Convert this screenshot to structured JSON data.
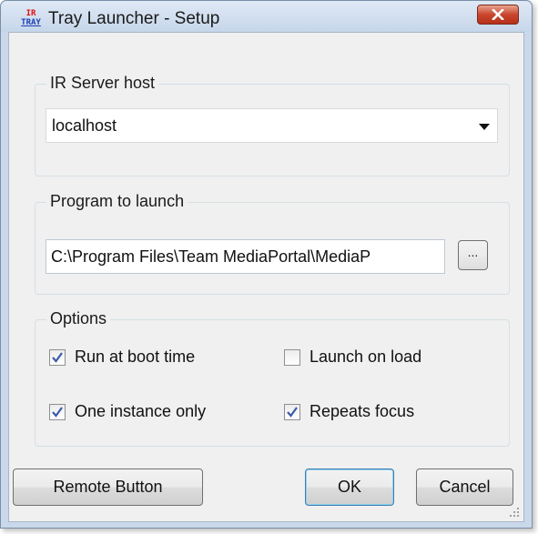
{
  "window": {
    "title": "Tray Launcher - Setup",
    "icon_text_top": "IR",
    "icon_text_bottom": "TRAY"
  },
  "ir_server_group": {
    "label": "IR Server host",
    "host_value": "localhost"
  },
  "program_group": {
    "label": "Program to launch",
    "path_value": "C:\\Program Files\\Team MediaPortal\\MediaP",
    "browse_label": "..."
  },
  "options_group": {
    "label": "Options",
    "items": [
      {
        "label": "Run at boot time",
        "checked": true
      },
      {
        "label": "Launch on load",
        "checked": false
      },
      {
        "label": "One instance only",
        "checked": true
      },
      {
        "label": "Repeats focus",
        "checked": true
      }
    ]
  },
  "buttons": {
    "remote": "Remote Button",
    "ok": "OK",
    "cancel": "Cancel"
  },
  "colors": {
    "frame": "#c9d8ea",
    "client": "#f0f0f0",
    "close_button": "#c9452e",
    "check_mark": "#3a5ca8"
  }
}
